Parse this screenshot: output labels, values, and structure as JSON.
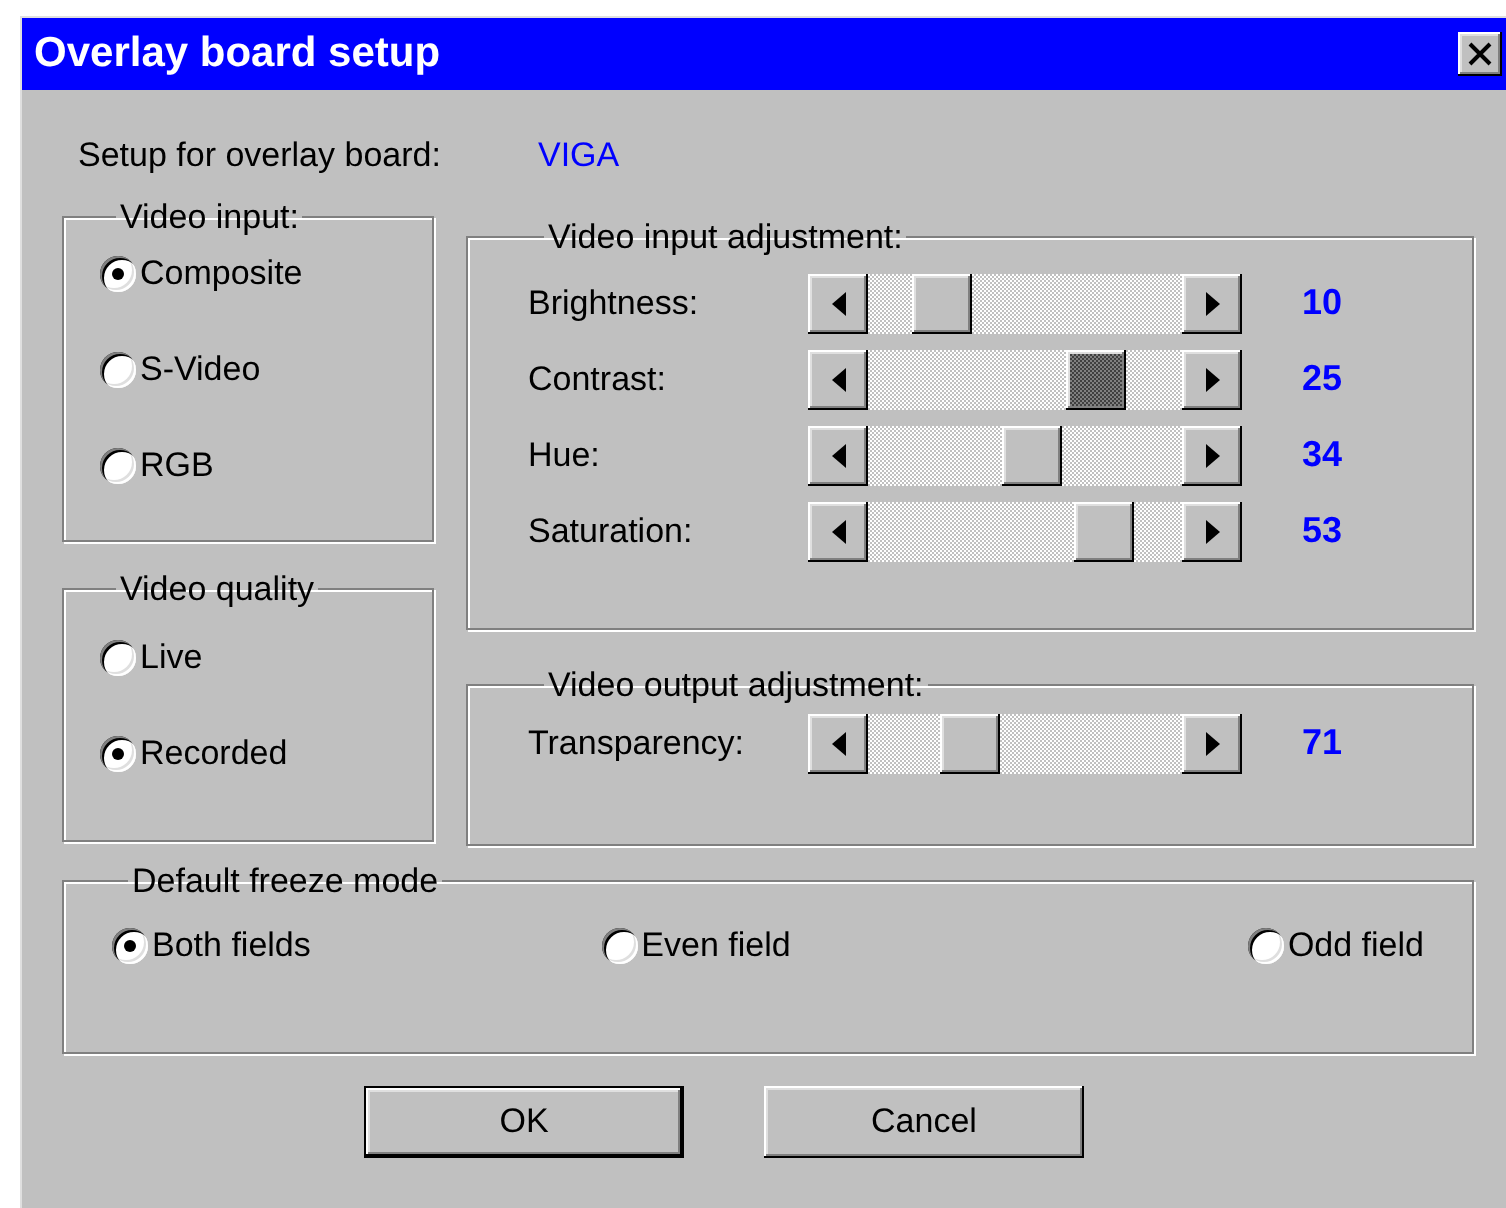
{
  "window": {
    "title": "Overlay board setup"
  },
  "board": {
    "label": "Setup for overlay board:",
    "value": "VIGA"
  },
  "video_input": {
    "title": "Video input:",
    "options": [
      {
        "label": "Composite",
        "selected": true
      },
      {
        "label": "S-Video",
        "selected": false
      },
      {
        "label": "RGB",
        "selected": false
      }
    ]
  },
  "video_quality": {
    "title": "Video quality",
    "options": [
      {
        "label": "Live",
        "selected": false
      },
      {
        "label": "Recorded",
        "selected": true
      }
    ]
  },
  "input_adjustment": {
    "title": "Video input adjustment:",
    "sliders": [
      {
        "label": "Brightness:",
        "level": 0.17,
        "reading": "10",
        "focused": false
      },
      {
        "label": "Contrast:",
        "level": 0.78,
        "reading": "25",
        "focused": true
      },
      {
        "label": "Hue:",
        "level": 0.53,
        "reading": "34",
        "focused": false
      },
      {
        "label": "Saturation:",
        "level": 0.81,
        "reading": "53",
        "focused": false
      }
    ]
  },
  "output_adjustment": {
    "title": "Video output adjustment:",
    "sliders": [
      {
        "label": "Transparency:",
        "level": 0.28,
        "reading": "71",
        "focused": false
      }
    ]
  },
  "freeze_mode": {
    "title": "Default freeze mode",
    "options": [
      {
        "label": "Both fields",
        "selected": true
      },
      {
        "label": "Even field",
        "selected": false
      },
      {
        "label": "Odd field",
        "selected": false
      }
    ]
  },
  "buttons": [
    {
      "label": "OK",
      "default": true
    },
    {
      "label": "Cancel",
      "default": false
    }
  ]
}
